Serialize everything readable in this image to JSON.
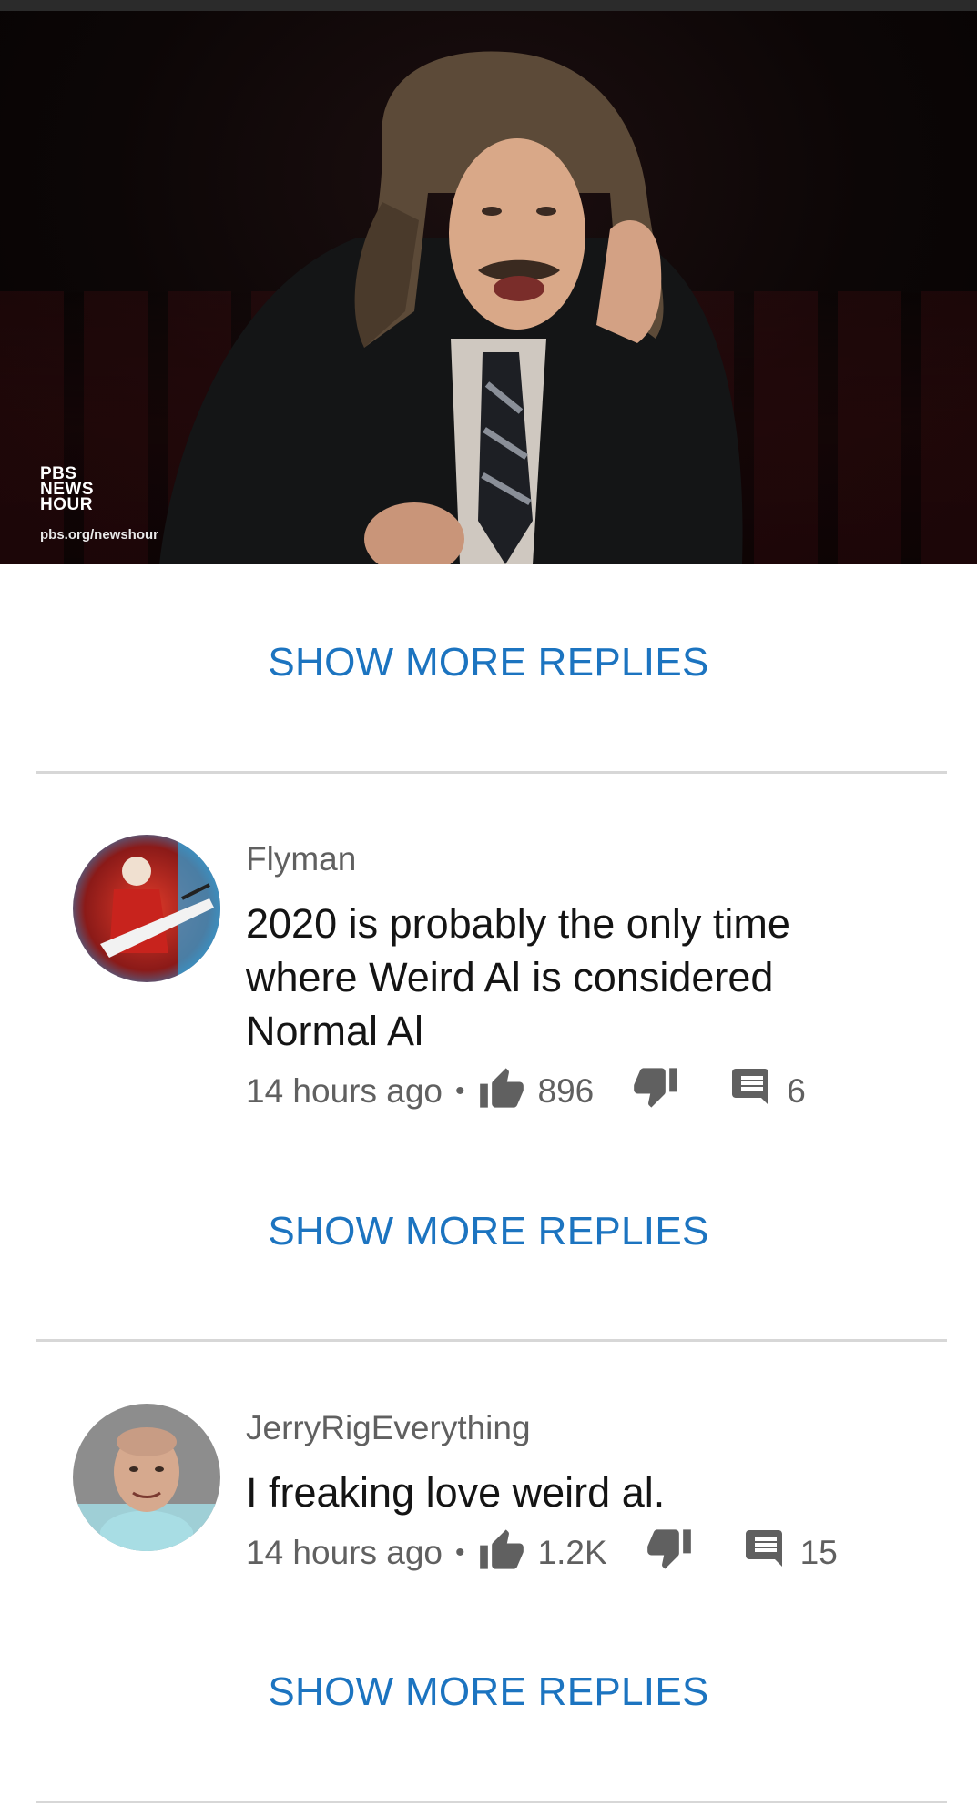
{
  "video": {
    "watermark_lines": [
      "PBS",
      "NEWS",
      "HOUR"
    ],
    "watermark_url": "pbs.org/newshour"
  },
  "replies_label": "SHOW MORE REPLIES",
  "comments": [
    {
      "author": "Flyman",
      "text": "2020 is probably the only time where Weird Al is considered Normal Al",
      "time": "14 hours ago",
      "likes": "896",
      "replies": "6"
    },
    {
      "author": "JerryRigEverything",
      "text": "I freaking love weird al.",
      "time": "14 hours ago",
      "likes": "1.2K",
      "replies": "15"
    }
  ],
  "colors": {
    "accent": "#1c74c0",
    "meta": "#606060",
    "text": "#141414",
    "divider": "#d7d7d7"
  },
  "icons": {
    "like": "thumb-up-icon",
    "dislike": "thumb-down-icon",
    "reply": "comment-icon",
    "separator": "bullet-icon"
  }
}
